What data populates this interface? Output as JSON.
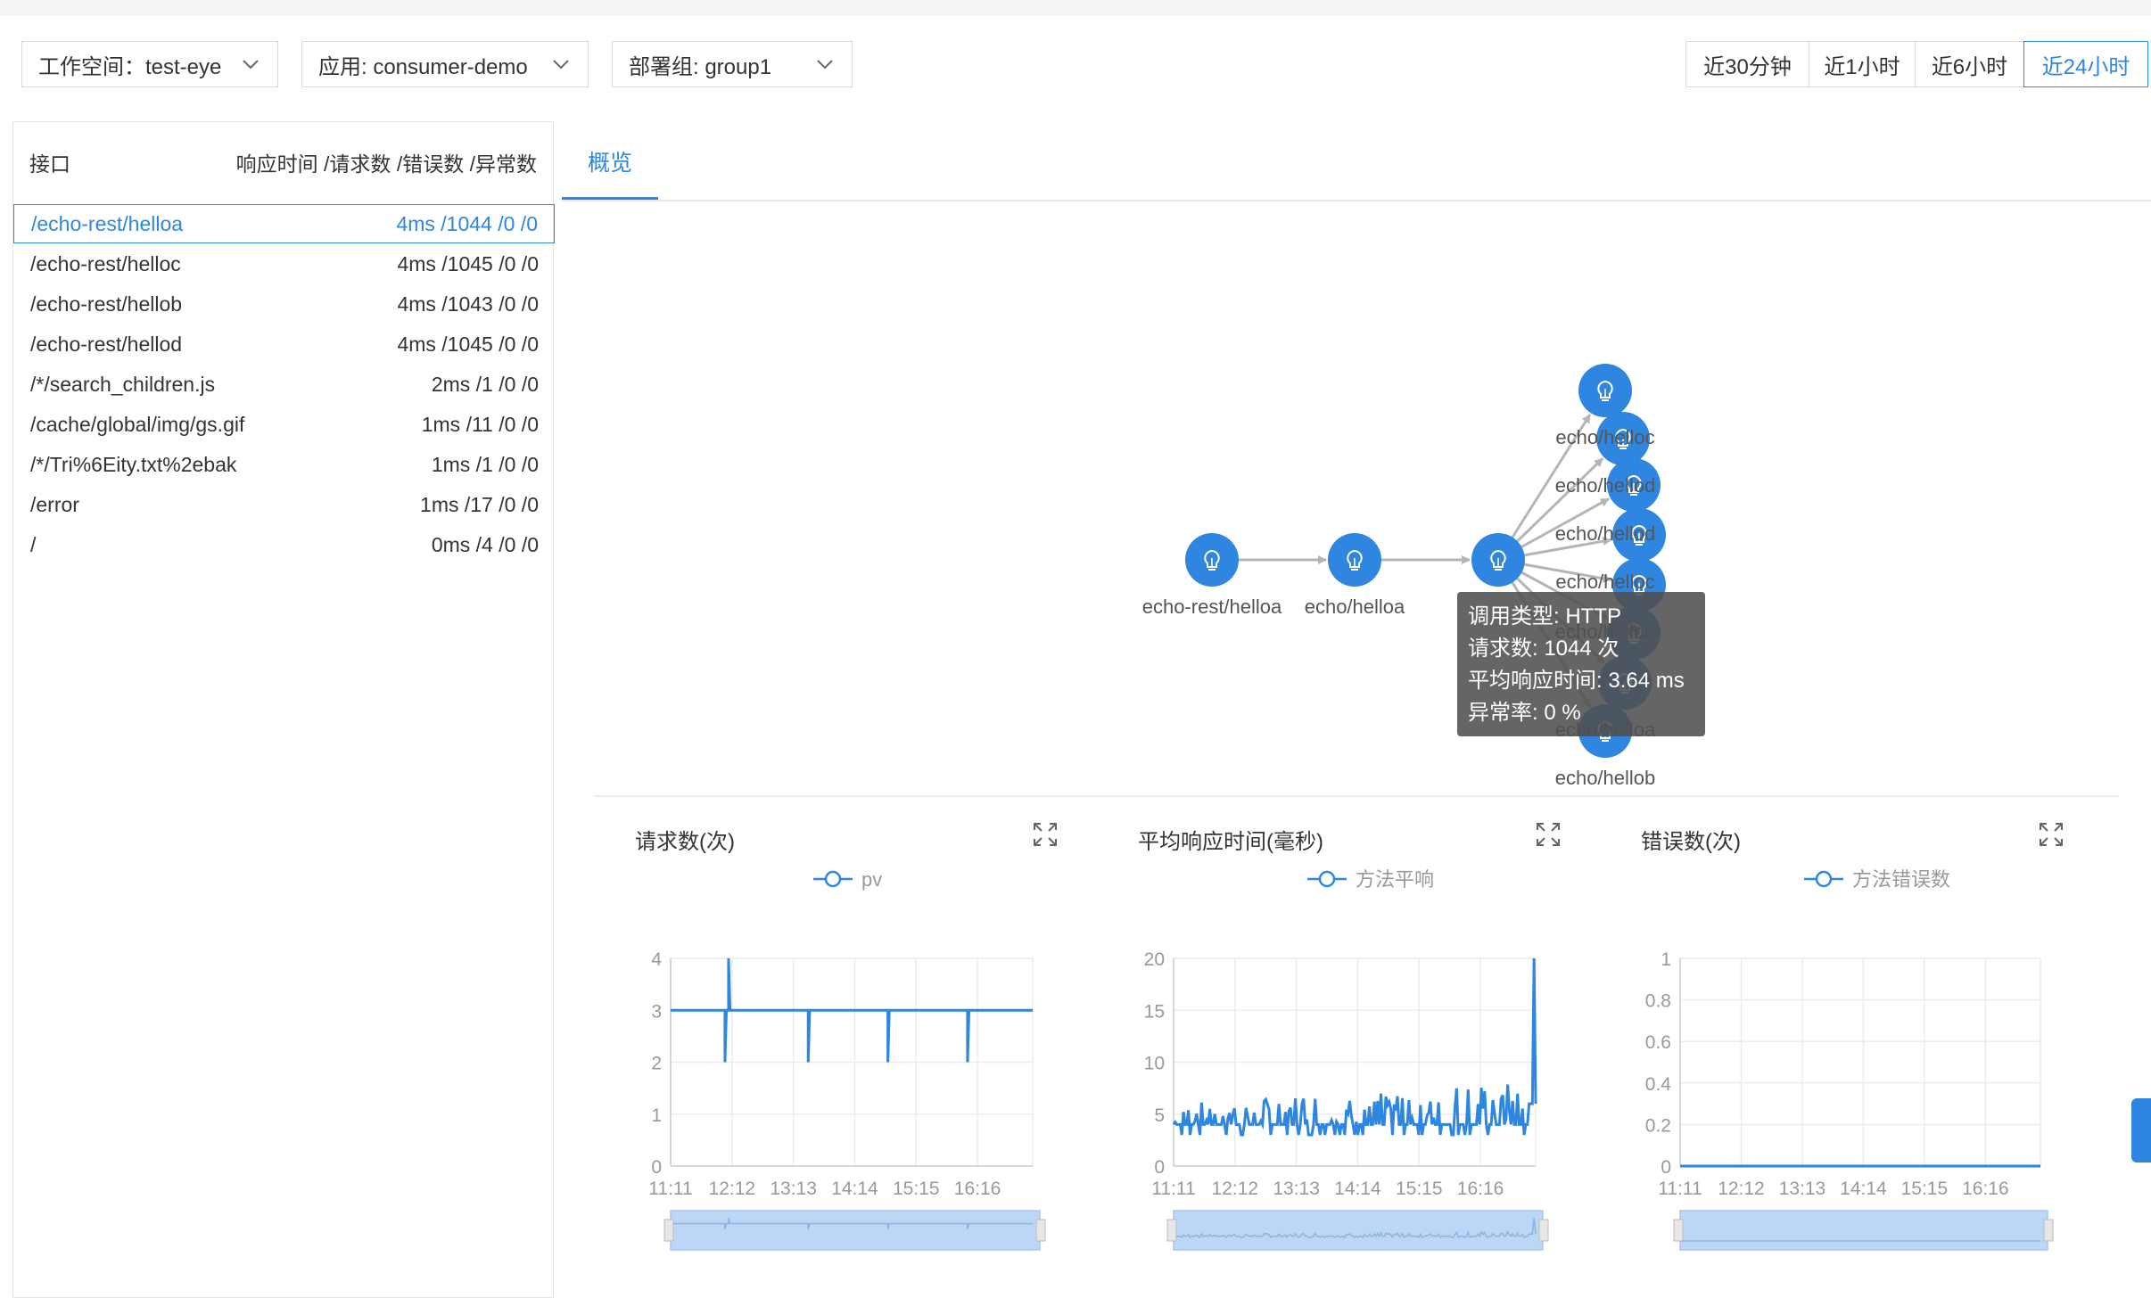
{
  "filters": {
    "workspace": "工作空间：test-eye",
    "app": "应用: consumer-demo",
    "group": "部署组: group1"
  },
  "time_ranges": [
    {
      "label": "近30分钟",
      "active": false
    },
    {
      "label": "近1小时",
      "active": false
    },
    {
      "label": "近6小时",
      "active": false
    },
    {
      "label": "近24小时",
      "active": true
    }
  ],
  "interface_list": {
    "header_left": "接口",
    "header_right": "响应时间 /请求数 /错误数 /异常数",
    "rows": [
      {
        "path": "/echo-rest/helloa",
        "stats": "4ms /1044 /0 /0",
        "selected": true
      },
      {
        "path": "/echo-rest/helloc",
        "stats": "4ms /1045 /0 /0",
        "selected": false
      },
      {
        "path": "/echo-rest/hellob",
        "stats": "4ms /1043 /0 /0",
        "selected": false
      },
      {
        "path": "/echo-rest/hellod",
        "stats": "4ms /1045 /0 /0",
        "selected": false
      },
      {
        "path": "/*/search_children.js",
        "stats": "2ms /1 /0 /0",
        "selected": false
      },
      {
        "path": "/cache/global/img/gs.gif",
        "stats": "1ms /11 /0 /0",
        "selected": false
      },
      {
        "path": "/*/Tri%6Eity.txt%2ebak",
        "stats": "1ms /1 /0 /0",
        "selected": false
      },
      {
        "path": "/error",
        "stats": "1ms /17 /0 /0",
        "selected": false
      },
      {
        "path": "/",
        "stats": "0ms /4 /0 /0",
        "selected": false
      }
    ]
  },
  "tab": {
    "label": "概览"
  },
  "topology": {
    "node_labels": [
      "echo-rest/helloa",
      "echo/helloa"
    ],
    "fan_labels": [
      "echo/helloc",
      "echo/hellod",
      "echo/hellod",
      "echo/helloc",
      "echo/hellob",
      "echo/helloa"
    ],
    "bottom_label": "echo/hellob",
    "icon": "lightbulb-icon",
    "node_color": "#2f86e0"
  },
  "tooltip": {
    "type": "调用类型: HTTP",
    "requests": "请求数: 1044 次",
    "avg_rt": "平均响应时间: 3.64 ms",
    "error_rate": "异常率: 0 %"
  },
  "charts": {
    "requests": {
      "title": "请求数(次)",
      "legend": "pv"
    },
    "avg_rt": {
      "title": "平均响应时间(毫秒)",
      "legend": "方法平响"
    },
    "errors": {
      "title": "错误数(次)",
      "legend": "方法错误数"
    }
  },
  "chart_data": [
    {
      "type": "line",
      "title": "请求数(次)",
      "x_ticks": [
        "11:11",
        "12:12",
        "13:13",
        "14:14",
        "15:15",
        "16:16"
      ],
      "yticks": [
        "0",
        "1",
        "2",
        "3",
        "4"
      ],
      "ylim": [
        0,
        4
      ],
      "series": [
        {
          "name": "pv",
          "baseline": 3,
          "spikes": [
            {
              "t": 0.15,
              "v": 2
            },
            {
              "t": 0.16,
              "v": 4
            },
            {
              "t": 0.38,
              "v": 2
            },
            {
              "t": 0.6,
              "v": 2
            },
            {
              "t": 0.82,
              "v": 2
            }
          ]
        }
      ]
    },
    {
      "type": "line",
      "title": "平均响应时间(毫秒)",
      "x_ticks": [
        "11:11",
        "12:12",
        "13:13",
        "14:14",
        "15:15",
        "16:16"
      ],
      "yticks": [
        "0",
        "5",
        "10",
        "15",
        "20"
      ],
      "ylim": [
        0,
        20
      ],
      "series": [
        {
          "name": "方法平响",
          "baseline": 4,
          "noise_max": 8,
          "peak": {
            "t": 0.985,
            "v": 20
          }
        }
      ]
    },
    {
      "type": "line",
      "title": "错误数(次)",
      "x_ticks": [
        "11:11",
        "12:12",
        "13:13",
        "14:14",
        "15:15",
        "16:16"
      ],
      "yticks": [
        "0",
        "0.2",
        "0.4",
        "0.6",
        "0.8",
        "1"
      ],
      "ylim": [
        0,
        1
      ],
      "series": [
        {
          "name": "方法错误数",
          "constant": 0
        }
      ]
    }
  ]
}
